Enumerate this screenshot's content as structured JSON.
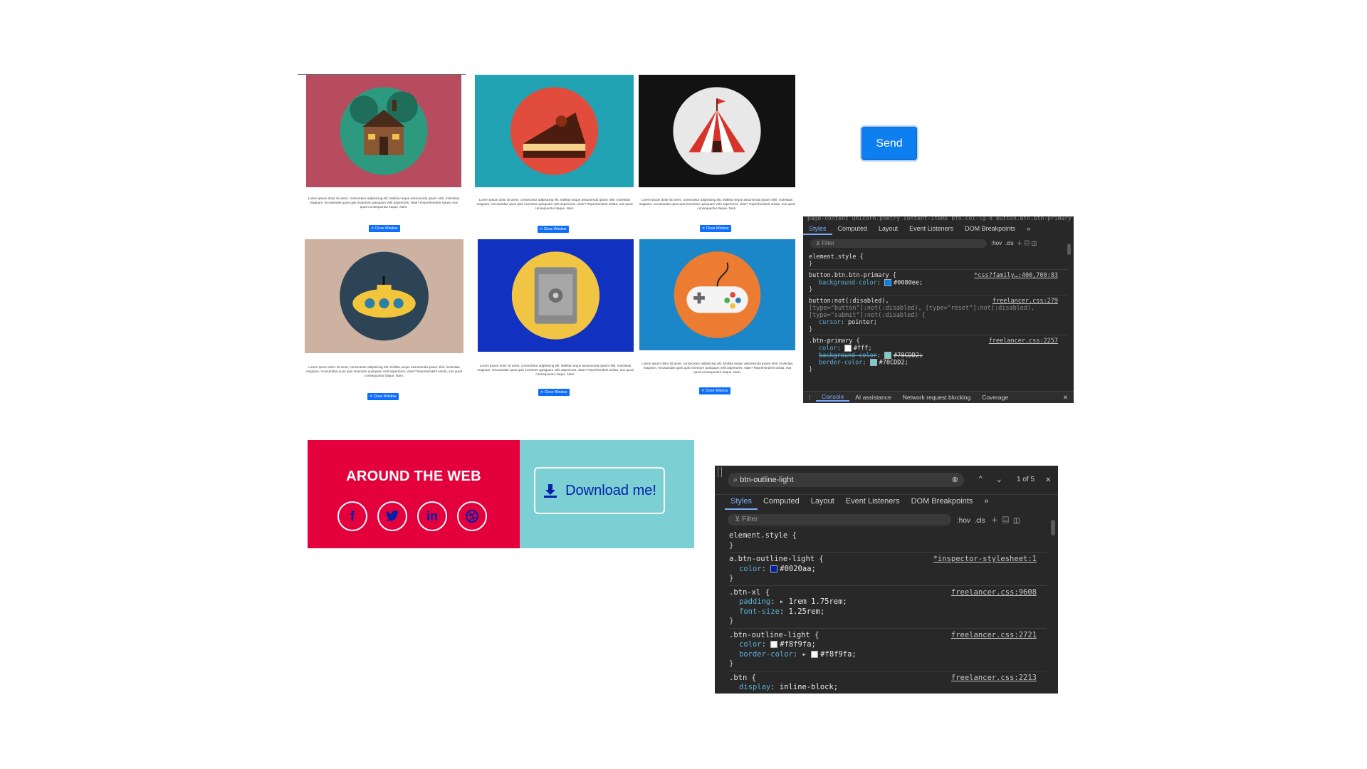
{
  "lorem": "Lorem ipsum dolor sit amet, consectetur adipisicing elit. Mollitia neque assumenda ipsam nihil, molestias magnam, recusandae quos quis inventore quisquam velit asperiores, vitae? Reprehenderit soluta, eos quod consequuntur itaque. Nam.",
  "close_label": "✕ Close Window",
  "portfolio": [
    {
      "name": "cabin",
      "bg": "#b84c5f"
    },
    {
      "name": "cake",
      "bg": "#21a3b4"
    },
    {
      "name": "circus",
      "bg": "#121212"
    },
    {
      "name": "submarine",
      "bg": "#cdb2a2"
    },
    {
      "name": "safe",
      "bg": "#1131c1"
    },
    {
      "name": "game",
      "bg": "#1b86c8"
    }
  ],
  "send_label": "Send",
  "devtools1": {
    "breadcrumb": "page-content  unicorn.poetry content-items  btn.col-lg-8  button.btn.btn-primary",
    "tabs": [
      "Styles",
      "Computed",
      "Layout",
      "Event Listeners",
      "DOM Breakpoints"
    ],
    "filter": "Filter",
    "hov": ":hov",
    "cls": ".cls",
    "rules": [
      {
        "selector": "element.style {",
        "close": "}"
      },
      {
        "selector": "button.btn.btn-primary {",
        "source": "*css?family…:400,700:83",
        "props": [
          {
            "name": "background-color",
            "value": "#0080ee;",
            "color": "#0080ee"
          }
        ],
        "close": "}"
      },
      {
        "selector": "button:not(:disabled),",
        "extra": "[type=\"button\"]:not(:disabled), [type=\"reset\"]:not(:disabled),",
        "extra2": "[type=\"submit\"]:not(:disabled) {",
        "source": "freelancer.css:279",
        "props": [
          {
            "name": "cursor",
            "value": "pointer;"
          }
        ],
        "close": "}"
      },
      {
        "selector": ".btn-primary {",
        "source": "freelancer.css:2257",
        "props": [
          {
            "name": "color",
            "value": "#fff;",
            "color": "#ffffff"
          },
          {
            "name": "background-color",
            "value": "#78CDD2;",
            "color": "#78CDD2",
            "struck": true
          },
          {
            "name": "border-color",
            "value": "#78CDD2;",
            "color": "#78CDD2"
          }
        ],
        "close": "}"
      }
    ],
    "drawer": [
      "Console",
      "AI assistance",
      "Network request blocking",
      "Coverage"
    ]
  },
  "around": {
    "title": "AROUND THE WEB",
    "socials": [
      {
        "name": "facebook",
        "glyph": "f"
      },
      {
        "name": "twitter",
        "glyph": "t"
      },
      {
        "name": "linkedin",
        "glyph": "in"
      },
      {
        "name": "dribbble",
        "glyph": "◎"
      }
    ]
  },
  "download_label": "Download me!",
  "devtools2": {
    "search_value": "btn-outline-light",
    "match_count": "1 of 5",
    "tabs": [
      "Styles",
      "Computed",
      "Layout",
      "Event Listeners",
      "DOM Breakpoints"
    ],
    "filter": "Filter",
    "hov": ":hov",
    "cls": ".cls",
    "rules": [
      {
        "selector": "element.style {",
        "close": "}"
      },
      {
        "selector": "a.btn-outline-light {",
        "source": "*inspector-stylesheet:1",
        "props": [
          {
            "name": "color",
            "value": "#0020aa;",
            "color": "#0020aa"
          }
        ],
        "close": "}"
      },
      {
        "selector": ".btn-xl {",
        "source": "freelancer.css:9608",
        "props": [
          {
            "name": "padding",
            "value": "1rem 1.75rem;",
            "arrow": true
          },
          {
            "name": "font-size",
            "value": "1.25rem;"
          }
        ],
        "close": "}"
      },
      {
        "selector": ".btn-outline-light {",
        "source": "freelancer.css:2721",
        "props": [
          {
            "name": "color",
            "value": "#f8f9fa;",
            "color": "#f8f9fa"
          },
          {
            "name": "border-color",
            "value": "#f8f9fa;",
            "color": "#f8f9fa",
            "arrow": true
          }
        ],
        "close": "}"
      },
      {
        "selector": ".btn {",
        "source": "freelancer.css:2213",
        "props": [
          {
            "name": "display",
            "value": "inline-block;"
          }
        ]
      }
    ]
  }
}
